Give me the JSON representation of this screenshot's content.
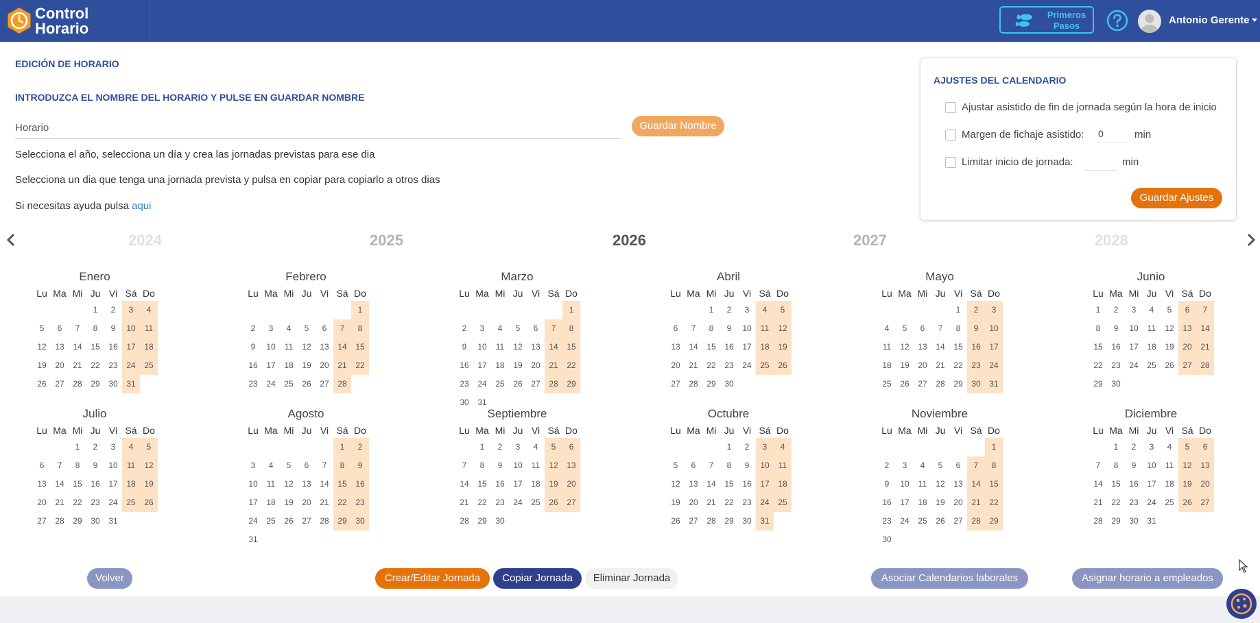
{
  "app": {
    "brand_line1": "Control",
    "brand_line2": "Horario"
  },
  "header": {
    "primeros_pasos_line1": "Primeros",
    "primeros_pasos_line2": "Pasos",
    "user_name": "Antonio Gerente"
  },
  "editor": {
    "title": "EDICIÓN DE HORARIO",
    "subtitle": "INTRODUZCA EL NOMBRE DEL HORARIO Y PULSE EN GUARDAR NOMBRE",
    "name_value": "Horario",
    "save_name_label": "Guardar Nombre",
    "info1": "Selecciona el año, selecciona un día y crea las jornadas previstas para ese dia",
    "info2": "Selecciona un dia que tenga una jornada prevista y pulsa en copiar para copiarlo a otros dias",
    "help_prefix": "Si necesitas ayuda pulsa",
    "help_link": "aqui"
  },
  "settings": {
    "title": "AJUSTES DEL CALENDARIO",
    "opt1_label": "Ajustar asistido de fin de jornada según la hora de inicio",
    "opt2_label": "Margen de fichaje asistido:",
    "opt2_value": "0",
    "opt2_unit": "min",
    "opt3_label": "Limitar inicio de jornada:",
    "opt3_value": "",
    "opt3_unit": "min",
    "save_label": "Guardar Ajustes"
  },
  "years": {
    "y1": "2024",
    "y2": "2025",
    "y3": "2026",
    "y4": "2027",
    "y5": "2028",
    "selected": "2026"
  },
  "weekdays": [
    "Lu",
    "Ma",
    "Mi",
    "Ju",
    "Vi",
    "Sá",
    "Do"
  ],
  "months": [
    {
      "name": "Enero",
      "offset": 3,
      "days": 31
    },
    {
      "name": "Febrero",
      "offset": 6,
      "days": 28
    },
    {
      "name": "Marzo",
      "offset": 6,
      "days": 31
    },
    {
      "name": "Abril",
      "offset": 2,
      "days": 30
    },
    {
      "name": "Mayo",
      "offset": 4,
      "days": 31
    },
    {
      "name": "Junio",
      "offset": 0,
      "days": 30
    },
    {
      "name": "Julio",
      "offset": 2,
      "days": 31
    },
    {
      "name": "Agosto",
      "offset": 5,
      "days": 31
    },
    {
      "name": "Septiembre",
      "offset": 1,
      "days": 30
    },
    {
      "name": "Octubre",
      "offset": 3,
      "days": 31
    },
    {
      "name": "Noviembre",
      "offset": 6,
      "days": 30
    },
    {
      "name": "Diciembre",
      "offset": 1,
      "days": 31
    }
  ],
  "actions": {
    "back": "Volver",
    "create_edit": "Crear/Editar Jornada",
    "copy": "Copiar Jornada",
    "delete": "Eliminar Jornada",
    "assoc_calendars": "Asociar Calendarios laborales",
    "assign_employees": "Asignar horario a empleados"
  },
  "colors": {
    "header": "#2f4f9c",
    "accent": "#e6720a",
    "weekend": "#fde2c6",
    "navy_button": "#2f3f8c"
  },
  "icons": [
    "clock-logo-icon",
    "footprints-icon",
    "help-circle-icon",
    "user-avatar-icon",
    "caret-down-icon",
    "chevron-left-icon",
    "chevron-right-icon",
    "cookie-icon"
  ]
}
